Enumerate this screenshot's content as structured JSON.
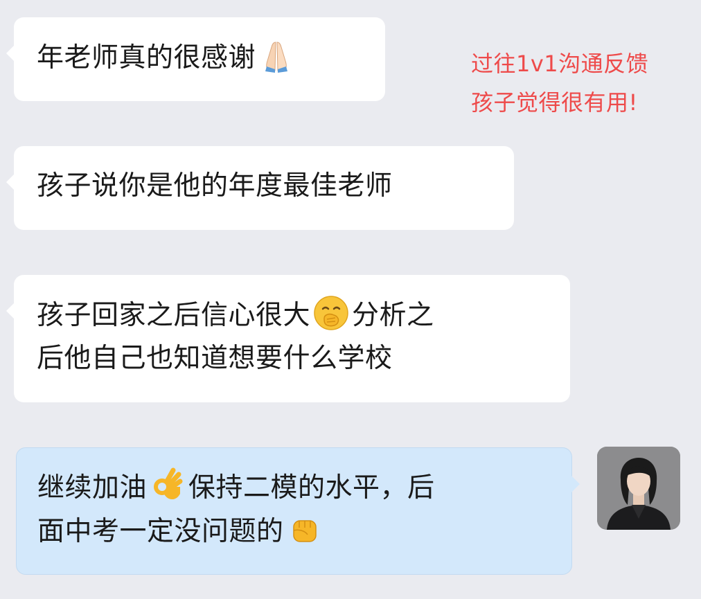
{
  "annotation": {
    "line1": "过往1v1沟通反馈",
    "line2": "孩子觉得很有用!",
    "color": "#ee4a4a"
  },
  "messages": [
    {
      "sender": "other",
      "line1_text": "年老师真的很感谢",
      "line1_emoji": "folded-hands-emoji"
    },
    {
      "sender": "other",
      "line1_text": "孩子说你是他的年度最佳老师"
    },
    {
      "sender": "other",
      "line1_before": "孩子回家之后信心很大",
      "line1_emoji": "hand-over-mouth-emoji",
      "line1_after": "分析之",
      "line2_text": "后他自己也知道想要什么学校"
    },
    {
      "sender": "self",
      "line1_before": "继续加油",
      "line1_emoji": "ok-hand-emoji",
      "line1_after": "保持二模的水平，后",
      "line2_before": "面中考一定没问题的",
      "line2_emoji": "raised-fist-emoji"
    }
  ],
  "colors": {
    "background": "#eaebf0",
    "incoming_bubble": "#ffffff",
    "outgoing_bubble": "#d3e8fb"
  },
  "avatar": {
    "icon": "user-avatar"
  }
}
